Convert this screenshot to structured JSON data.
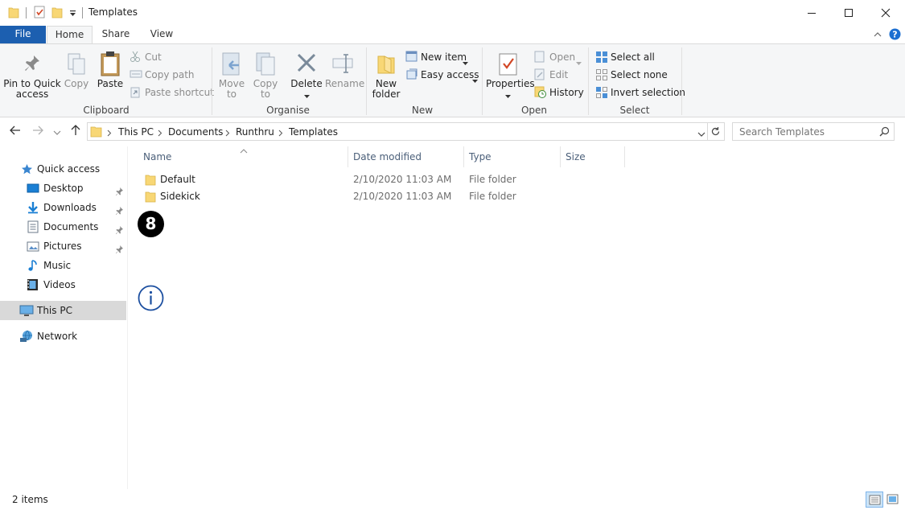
{
  "window": {
    "title": "Templates"
  },
  "ribbon_tabs": [
    {
      "label": "File"
    },
    {
      "label": "Home"
    },
    {
      "label": "Share"
    },
    {
      "label": "View"
    }
  ],
  "ribbon": {
    "clipboard": {
      "group_label": "Clipboard",
      "pin_label_line1": "Pin to Quick",
      "pin_label_line2": "access",
      "copy_label": "Copy",
      "paste_label": "Paste",
      "cut_label": "Cut",
      "copy_path_label": "Copy path",
      "paste_shortcut_label": "Paste shortcut"
    },
    "organise": {
      "group_label": "Organise",
      "move_to_line1": "Move",
      "move_to_line2": "to",
      "copy_to_line1": "Copy",
      "copy_to_line2": "to",
      "delete_label": "Delete",
      "rename_label": "Rename"
    },
    "new": {
      "group_label": "New",
      "new_folder_line1": "New",
      "new_folder_line2": "folder",
      "new_item_label": "New item",
      "easy_access_label": "Easy access"
    },
    "open": {
      "group_label": "Open",
      "properties_label": "Properties",
      "open_label": "Open",
      "edit_label": "Edit",
      "history_label": "History"
    },
    "select": {
      "group_label": "Select",
      "select_all_label": "Select all",
      "select_none_label": "Select none",
      "invert_selection_label": "Invert selection"
    }
  },
  "address": {
    "breadcrumbs": [
      "This PC",
      "Documents",
      "Runthru",
      "Templates"
    ]
  },
  "search": {
    "placeholder": "Search Templates"
  },
  "nav_pane": {
    "quick_access": "Quick access",
    "items": [
      {
        "label": "Desktop",
        "pinned": true,
        "icon": "desktop-icon"
      },
      {
        "label": "Downloads",
        "pinned": true,
        "icon": "downloads-icon"
      },
      {
        "label": "Documents",
        "pinned": true,
        "icon": "documents-icon"
      },
      {
        "label": "Pictures",
        "pinned": true,
        "icon": "pictures-icon"
      },
      {
        "label": "Music",
        "pinned": false,
        "icon": "music-icon"
      },
      {
        "label": "Videos",
        "pinned": false,
        "icon": "videos-icon"
      }
    ],
    "this_pc": "This PC",
    "network": "Network"
  },
  "columns": {
    "name": "Name",
    "date_modified": "Date modified",
    "type": "Type",
    "size": "Size"
  },
  "files": [
    {
      "name": "Default",
      "date_modified": "2/10/2020 11:03 AM",
      "type": "File folder",
      "size": ""
    },
    {
      "name": "Sidekick",
      "date_modified": "2/10/2020 11:03 AM",
      "type": "File folder",
      "size": ""
    }
  ],
  "overlay": {
    "step_number": "8"
  },
  "status": {
    "item_count": "2 items"
  },
  "colors": {
    "accent": "#1c5fb0",
    "folder": "#f8d775",
    "selection": "#d9d9d9"
  }
}
